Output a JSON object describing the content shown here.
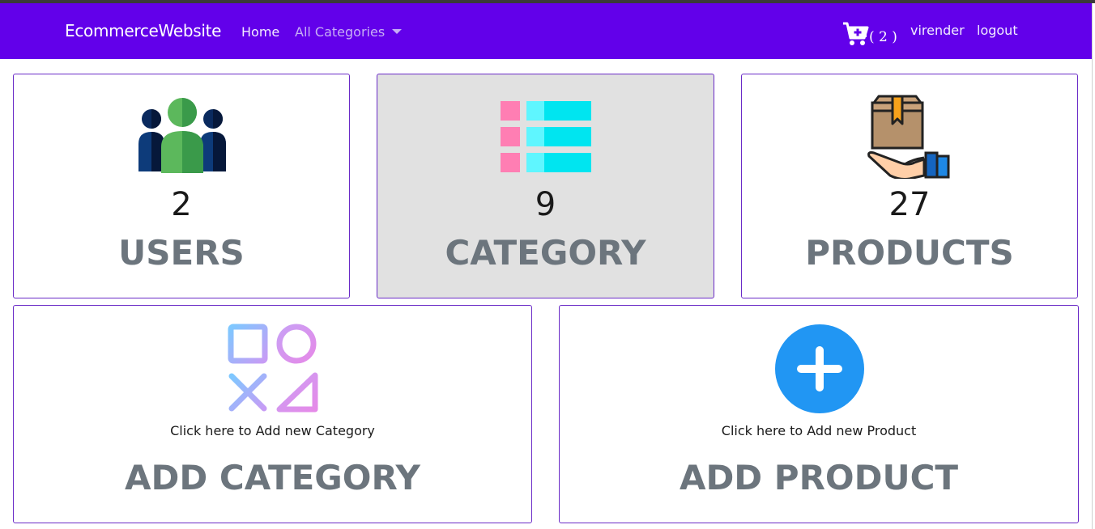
{
  "navbar": {
    "brand": "EcommerceWebsite",
    "home": "Home",
    "categories": "All Categories",
    "cart_count": "( 2 )",
    "user": "virender",
    "logout": "logout",
    "bg_color": "#6200ea"
  },
  "stats": [
    {
      "count": "2",
      "label": "USERS",
      "icon": "users-icon"
    },
    {
      "count": "9",
      "label": "CATEGORY",
      "icon": "list-icon"
    },
    {
      "count": "27",
      "label": "PRODUCTS",
      "icon": "product-box-hand-icon"
    }
  ],
  "actions": [
    {
      "hint": "Click here to Add new Category",
      "label": "ADD CATEGORY",
      "icon": "shapes-icon"
    },
    {
      "hint": "Click here to Add new Product",
      "label": "ADD PRODUCT",
      "icon": "plus-circle-icon"
    }
  ]
}
